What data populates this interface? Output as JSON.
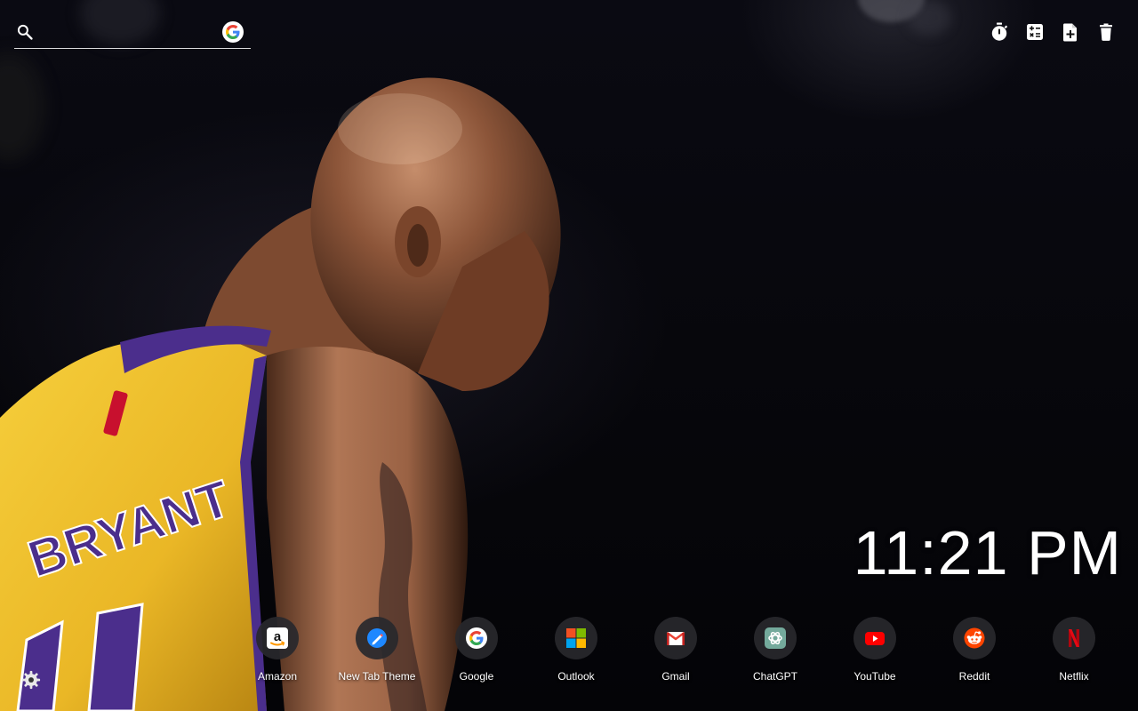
{
  "search": {
    "value": "",
    "placeholder": "",
    "engine_icon": "google-icon"
  },
  "toolbar": {
    "items": [
      {
        "name": "timer",
        "icon": "stopwatch-icon"
      },
      {
        "name": "calculator",
        "icon": "calculator-icon"
      },
      {
        "name": "new-note",
        "icon": "note-add-icon"
      },
      {
        "name": "delete",
        "icon": "trash-icon"
      }
    ]
  },
  "clock": {
    "time": "11:21 PM"
  },
  "background": {
    "jersey_lettering": "BRYANT"
  },
  "shortcuts": [
    {
      "label": "Amazon",
      "icon": "amazon-icon"
    },
    {
      "label": "New Tab Theme",
      "icon": "new-tab-theme-icon"
    },
    {
      "label": "Google",
      "icon": "google-icon"
    },
    {
      "label": "Outlook",
      "icon": "microsoft-icon"
    },
    {
      "label": "Gmail",
      "icon": "gmail-icon"
    },
    {
      "label": "ChatGPT",
      "icon": "chatgpt-icon"
    },
    {
      "label": "YouTube",
      "icon": "youtube-icon"
    },
    {
      "label": "Reddit",
      "icon": "reddit-icon"
    },
    {
      "label": "Netflix",
      "icon": "netflix-icon"
    }
  ],
  "colors": {
    "jersey_gold": "#f2c230",
    "jersey_purple": "#4b2e8c",
    "skin": "#a56a48",
    "text": "#ffffff"
  },
  "settings": {
    "icon": "gear-icon"
  }
}
